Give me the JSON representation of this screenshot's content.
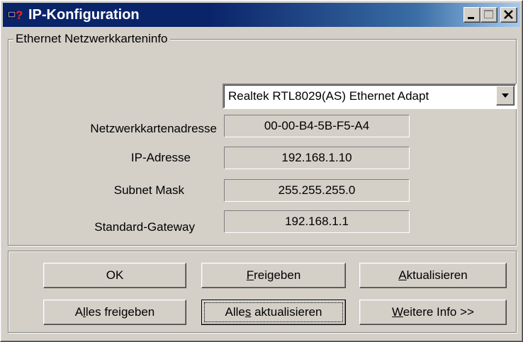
{
  "window": {
    "title": "IP-Konfiguration"
  },
  "group": {
    "legend": "Ethernet  Netzwerkkarteninfo"
  },
  "adapter": {
    "selected": "Realtek RTL8029(AS) Ethernet Adapt"
  },
  "fields": [
    {
      "label": "Netzwerkkartenadresse",
      "value": "00-00-B4-5B-F5-A4"
    },
    {
      "label": "IP-Adresse",
      "value": "192.168.1.10"
    },
    {
      "label": "Subnet Mask",
      "value": "255.255.255.0"
    },
    {
      "label": "Standard-Gateway",
      "value": "192.168.1.1"
    }
  ],
  "buttons": {
    "ok": "OK",
    "release_mn": "F",
    "release_rest": "reigeben",
    "renew_mn": "A",
    "renew_rest": "ktualisieren",
    "release_all_pre": "A",
    "release_all_mn": "l",
    "release_all_rest": "les freigeben",
    "renew_all_pre": "Alle",
    "renew_all_mn": "s",
    "renew_all_rest": " aktualisieren",
    "more_mn": "W",
    "more_rest": "eitere Info >>"
  },
  "icons": {
    "app": "network-question-icon",
    "minimize": "minimize-icon",
    "maximize": "maximize-icon",
    "close": "close-icon",
    "dropdown": "dropdown-arrow-icon"
  }
}
